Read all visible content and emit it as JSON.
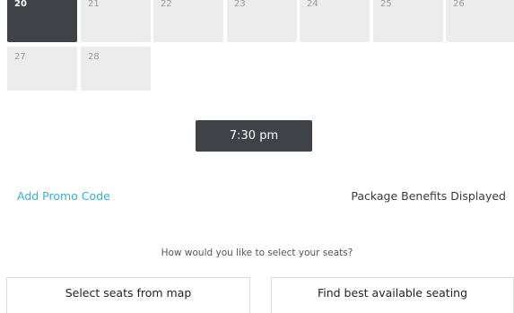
{
  "calendar": {
    "row1": [
      {
        "day": "20",
        "selected": true
      },
      {
        "day": "21",
        "selected": false
      },
      {
        "day": "22",
        "selected": false
      },
      {
        "day": "23",
        "selected": false
      },
      {
        "day": "24",
        "selected": false
      },
      {
        "day": "25",
        "selected": false
      },
      {
        "day": "26",
        "selected": false
      }
    ],
    "row2": [
      {
        "day": "27"
      },
      {
        "day": "28"
      }
    ]
  },
  "times": {
    "selected_time": "7:30 pm"
  },
  "links": {
    "promo_code": "Add Promo Code",
    "package_benefits": "Package Benefits Displayed"
  },
  "seat_selection": {
    "question": "How would you like to select your seats?",
    "from_map": "Select seats from map",
    "best_available": "Find best available seating"
  },
  "colors": {
    "selected_bg": "#3f4247",
    "day_bg": "#ececec",
    "link": "#2fb4d4"
  }
}
